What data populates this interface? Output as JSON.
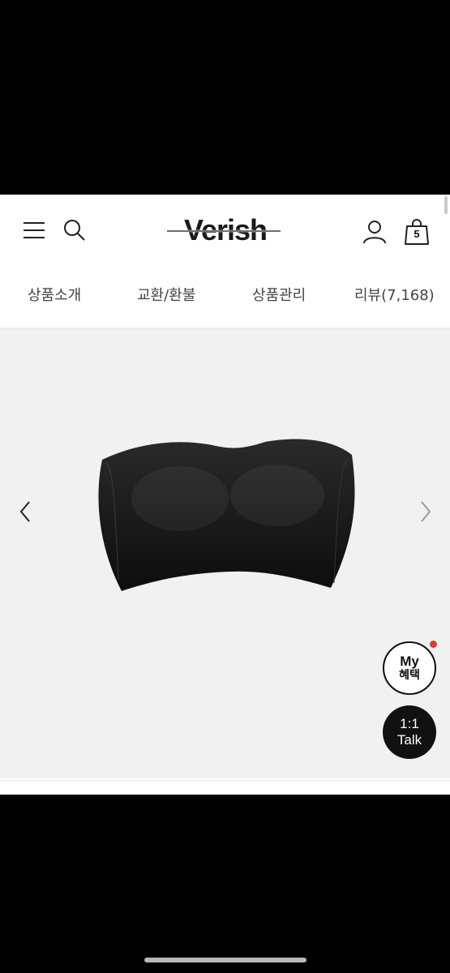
{
  "header": {
    "logo_text": "Verish",
    "cart_count": "5"
  },
  "tabs": [
    {
      "label": "상품소개"
    },
    {
      "label": "교환/환불"
    },
    {
      "label": "상품관리"
    },
    {
      "label": "리뷰(7,168)"
    }
  ],
  "floating": {
    "my_line1": "My",
    "my_line2": "혜택",
    "talk_line1": "1:1",
    "talk_line2": "Talk"
  },
  "icons": {
    "menu": "hamburger-menu-icon",
    "search": "search-icon",
    "user": "user-icon",
    "cart": "shopping-bag-icon",
    "prev": "chevron-left-icon",
    "next": "chevron-right-icon"
  },
  "colors": {
    "notification": "#e53935",
    "talk_button": "#111111",
    "gallery_bg": "#f1f1f1"
  }
}
